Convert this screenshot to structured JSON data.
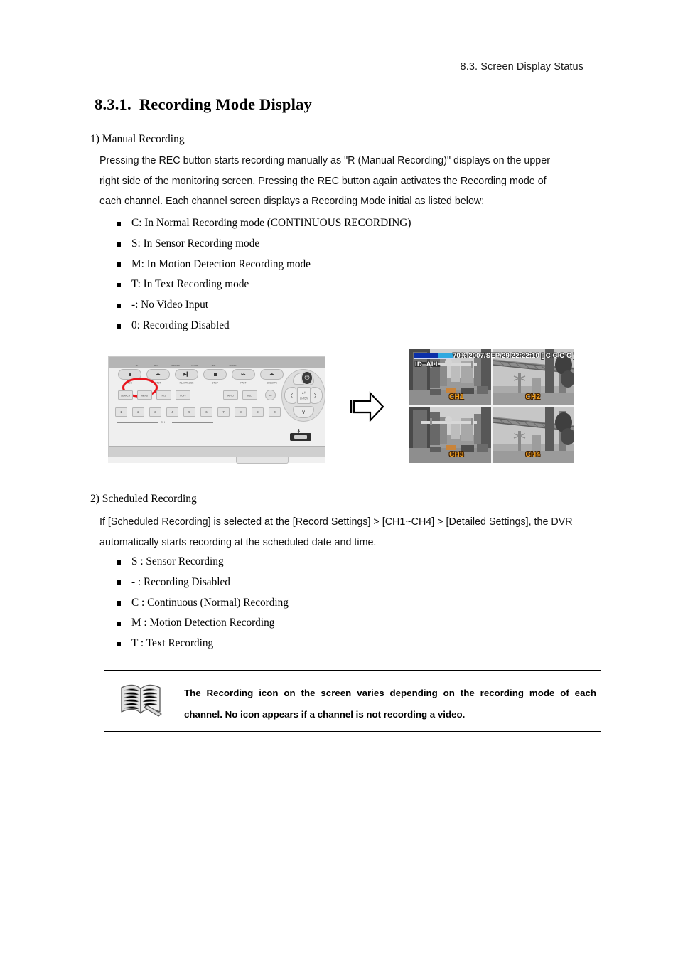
{
  "header": {
    "running_head": "8.3. Screen Display Status"
  },
  "heading": {
    "number": "8.3.1.",
    "title": "Recording Mode Display"
  },
  "section1": {
    "title": "1) Manual Recording",
    "paragraph_lines": [
      "Pressing the REC button starts recording manually as \"R (Manual Recording)\" displays on the upper",
      "right side of the monitoring screen. Pressing the REC button again activates the Recording mode of",
      "each channel. Each channel screen displays a Recording Mode initial as listed below:"
    ],
    "bullets": [
      "C: In Normal Recording mode (CONTINUOUS RECORDING)",
      "S: In Sensor Recording mode",
      "M: In Motion Detection Recording mode",
      "T: In Text Recording mode",
      "-: No Video Input",
      "0: Recording Disabled"
    ]
  },
  "figure": {
    "arrow_icon": "right-arrow-icon",
    "dvr": {
      "leds": [
        {
          "label": "PC"
        },
        {
          "label": "REC"
        },
        {
          "label": "NETWORK"
        },
        {
          "label": "ALARM"
        },
        {
          "label": "HDD"
        },
        {
          "label": "POWER"
        }
      ],
      "transport_buttons": [
        {
          "label": "REC",
          "glyph": "record"
        },
        {
          "label": "STOP",
          "glyph": "rew"
        },
        {
          "label": "PLAY/PAUSE",
          "glyph": "play"
        },
        {
          "label": "STEP",
          "glyph": "stop"
        },
        {
          "label": "FAST",
          "glyph": "ff"
        },
        {
          "label": "SLOW/PS",
          "glyph": "slow"
        }
      ],
      "function_buttons": [
        "SEARCH",
        "MENU",
        "PTZ",
        "COPY"
      ],
      "mode_buttons": [
        "AUTO",
        "MULT"
      ],
      "id_button": "I/D",
      "number_buttons": [
        "1",
        "2",
        "3",
        "4",
        "5",
        "6",
        "7",
        "8",
        "9",
        "0"
      ],
      "number_group_label": "CH",
      "dpad": {
        "up": "∧",
        "down": "∨",
        "left": "〈",
        "right": "〉",
        "enter_glyph": "↵",
        "enter_label": "ENTER"
      },
      "power_button": "⏻",
      "usb_label": "usb-icon"
    },
    "monitor": {
      "osd_status": "70% 2007/SEP/29 22:22:10  [ C C C C ]",
      "osd_id": "ID=ALL",
      "progress_percent": "70%",
      "bar_color": "#0b2fa8",
      "bar_fill_color": "#2fa8e0",
      "channel_label_color": "#f0a020",
      "channels": [
        {
          "label": "CH1"
        },
        {
          "label": "CH2"
        },
        {
          "label": "CH3"
        },
        {
          "label": "CH4"
        }
      ]
    }
  },
  "section2": {
    "title": "2) Scheduled Recording",
    "paragraph_lines": [
      "If [Scheduled Recording] is selected at the [Record Settings] > [CH1~CH4] > [Detailed Settings], the DVR",
      "automatically starts recording at the scheduled date and time."
    ],
    "bullets": [
      "S : Sensor Recording",
      "- : Recording Disabled",
      "C : Continuous (Normal) Recording",
      "M : Motion Detection Recording",
      "T : Text Recording"
    ]
  },
  "note": {
    "icon": "open-book-icon",
    "line1": "The Recording icon on the screen varies depending on the recording mode of each",
    "line2": "channel. No icon appears if a channel is not recording a video."
  }
}
